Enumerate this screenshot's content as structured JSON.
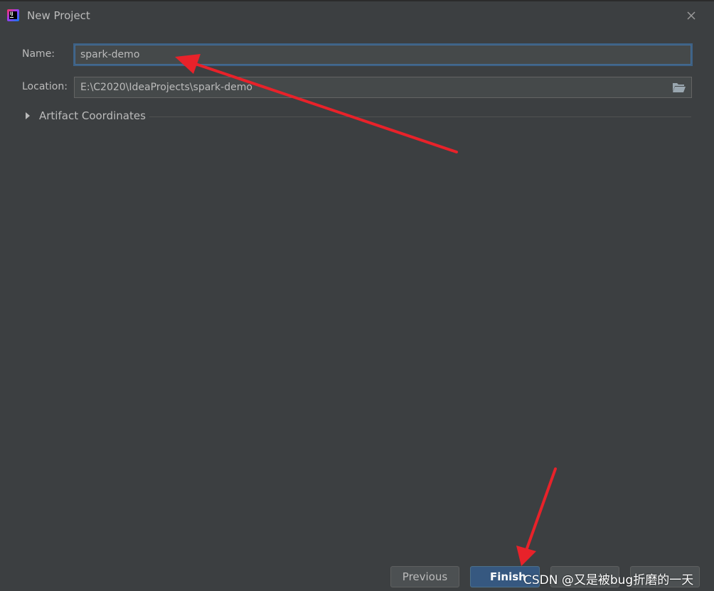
{
  "window": {
    "title": "New Project",
    "app_icon_text": "IJ"
  },
  "form": {
    "name_label": "Name:",
    "name_value": "spark-demo",
    "location_label": "Location:",
    "location_value": "E:\\C2020\\IdeaProjects\\spark-demo"
  },
  "sections": {
    "artifact_coordinates": "Artifact Coordinates",
    "expanded": false
  },
  "buttons": {
    "previous": "Previous",
    "finish": "Finish",
    "cancel": "",
    "help": ""
  },
  "watermark": "CSDN @又是被bug折磨的一天",
  "colors": {
    "background": "#3c3f41",
    "field": "#45494a",
    "focus_border": "#3d6185",
    "default_button": "#365880",
    "annotation_arrow": "#e8222a"
  }
}
